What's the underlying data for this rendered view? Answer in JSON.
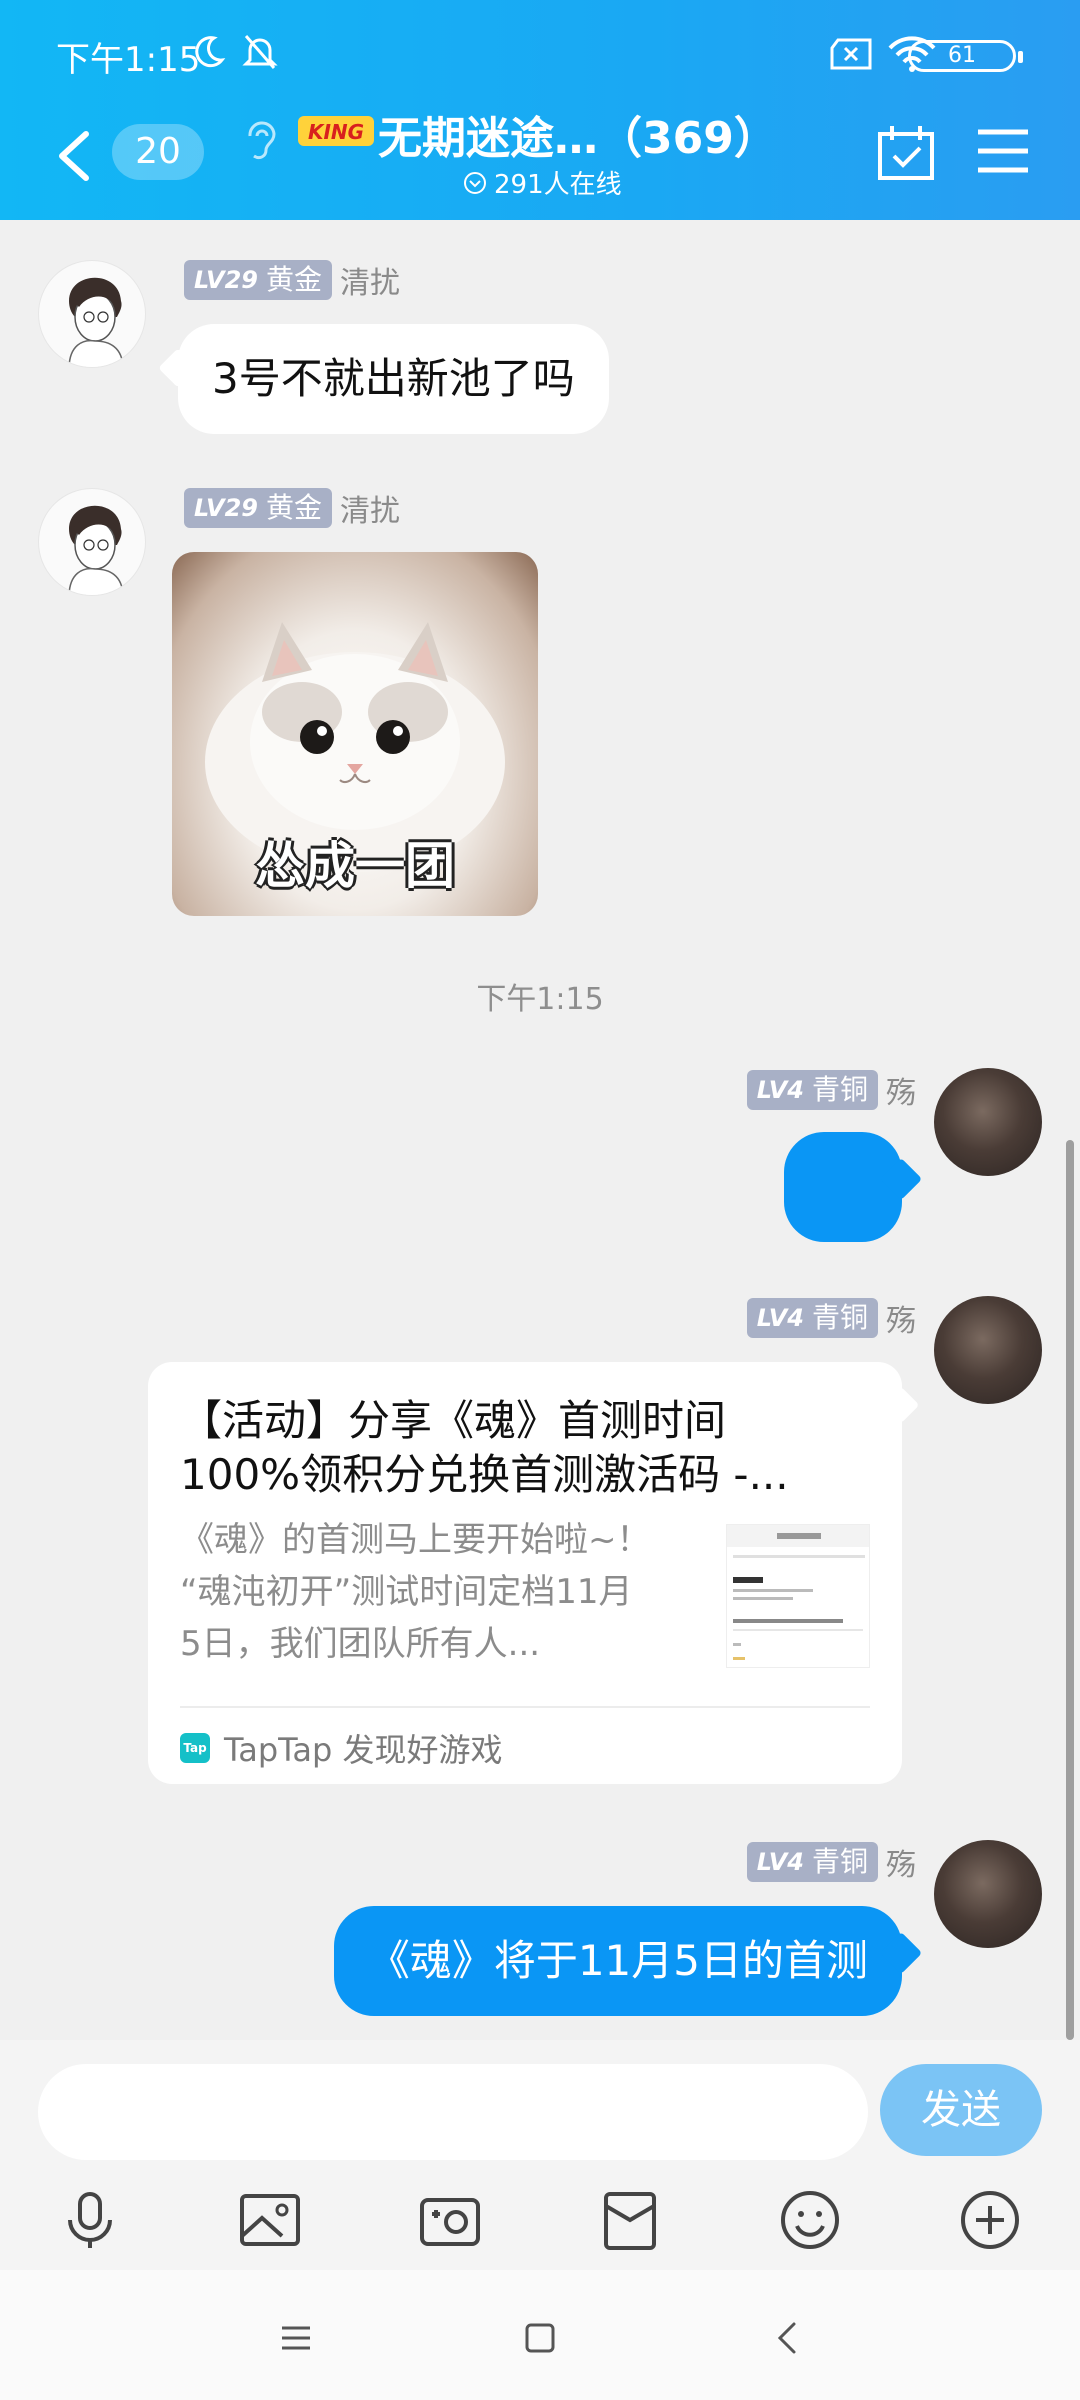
{
  "status_bar": {
    "time": "下午1:15",
    "battery": "61"
  },
  "header": {
    "unread_count": "20",
    "group_logo_text": "KING",
    "group_title": "无期迷途…（369）",
    "online_text": "291人在线",
    "accent_color": "#12b7f5"
  },
  "messages": [
    {
      "direction": "incoming",
      "level": "LV29",
      "rank": "黄金",
      "sender": "清扰",
      "text": "3号不就出新池了吗"
    },
    {
      "direction": "incoming",
      "level": "LV29",
      "rank": "黄金",
      "sender": "清扰",
      "sticker_caption": "怂成一团"
    },
    {
      "timestamp": "下午1:15"
    },
    {
      "direction": "outgoing",
      "level": "LV4",
      "rank": "青铜",
      "sender": "殇",
      "text": ""
    },
    {
      "direction": "outgoing",
      "level": "LV4",
      "rank": "青铜",
      "sender": "殇",
      "card": {
        "title_line1": "【活动】分享《魂》首测时间",
        "title_line2": "100%领积分兑换首测激活码 -...",
        "desc_line1": "《魂》的首测马上要开始啦~！",
        "desc_line2": "“魂沌初开”测试时间定档11月",
        "desc_line3": "5日，我们团队所有人...",
        "source": "TapTap 发现好游戏",
        "logo": "Tap"
      }
    },
    {
      "direction": "outgoing",
      "level": "LV4",
      "rank": "青铜",
      "sender": "殇",
      "text": "《魂》将于11月5日的首测"
    }
  ],
  "input": {
    "value": "",
    "send_label": "发送"
  },
  "toolbar": [
    "microphone-icon",
    "image-icon",
    "camera-icon",
    "red-packet-icon",
    "emoji-icon",
    "plus-icon"
  ],
  "colors": {
    "outgoing_bubble": "#0a96f5",
    "send_button": "#7bc4f5",
    "level_tag": "#a8b0c6"
  }
}
